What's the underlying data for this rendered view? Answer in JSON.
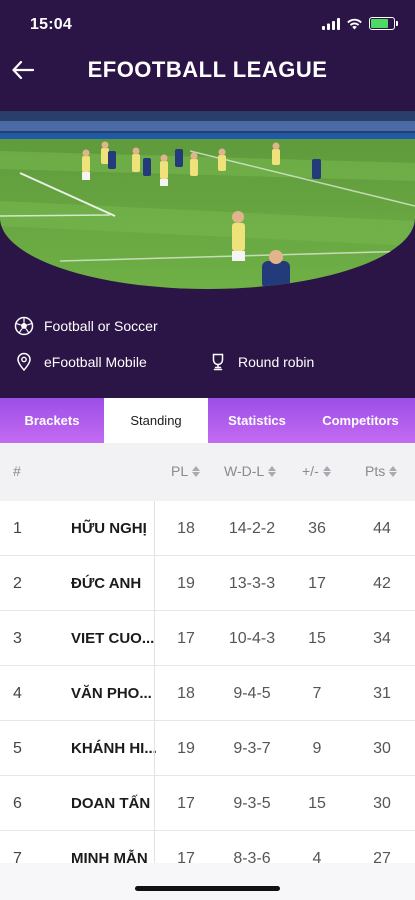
{
  "status_bar": {
    "time": "15:04",
    "battery_level": 0.75,
    "battery_color": "#4cd964"
  },
  "header": {
    "title": "EFOOTBALL LEAGUE",
    "background_color": "#2b1446",
    "back_icon": "arrow-left-icon"
  },
  "info": {
    "sport": {
      "icon": "soccer-ball-icon",
      "label": "Football or Soccer"
    },
    "game": {
      "icon": "location-pin-icon",
      "label": "eFootball Mobile"
    },
    "format": {
      "icon": "trophy-icon",
      "label": "Round robin"
    }
  },
  "tabs": [
    {
      "label": "Brackets",
      "active": false
    },
    {
      "label": "Standing",
      "active": true
    },
    {
      "label": "Statistics",
      "active": false
    },
    {
      "label": "Competitors",
      "active": false
    }
  ],
  "table": {
    "columns": {
      "rank": "#",
      "pl": "PL",
      "wdl": "W-D-L",
      "diff": "+/-",
      "pts": "Pts"
    },
    "rows": [
      {
        "rank": "1",
        "team": "HỮU NGHỊ",
        "pl": "18",
        "wdl": "14-2-2",
        "diff": "36",
        "pts": "44"
      },
      {
        "rank": "2",
        "team": "ĐỨC ANH",
        "pl": "19",
        "wdl": "13-3-3",
        "diff": "17",
        "pts": "42"
      },
      {
        "rank": "3",
        "team": "VIET CUO...",
        "pl": "17",
        "wdl": "10-4-3",
        "diff": "15",
        "pts": "34"
      },
      {
        "rank": "4",
        "team": "VĂN PHO...",
        "pl": "18",
        "wdl": "9-4-5",
        "diff": "7",
        "pts": "31"
      },
      {
        "rank": "5",
        "team": "KHÁNH HI...",
        "pl": "19",
        "wdl": "9-3-7",
        "diff": "9",
        "pts": "30"
      },
      {
        "rank": "6",
        "team": "DOAN TẤN",
        "pl": "17",
        "wdl": "9-3-5",
        "diff": "15",
        "pts": "30"
      },
      {
        "rank": "7",
        "team": "MINH MẪN",
        "pl": "17",
        "wdl": "8-3-6",
        "diff": "4",
        "pts": "27"
      }
    ]
  },
  "colors": {
    "tab_gradient_start": "#9b4ee6",
    "tab_gradient_end": "#c46bf2"
  }
}
